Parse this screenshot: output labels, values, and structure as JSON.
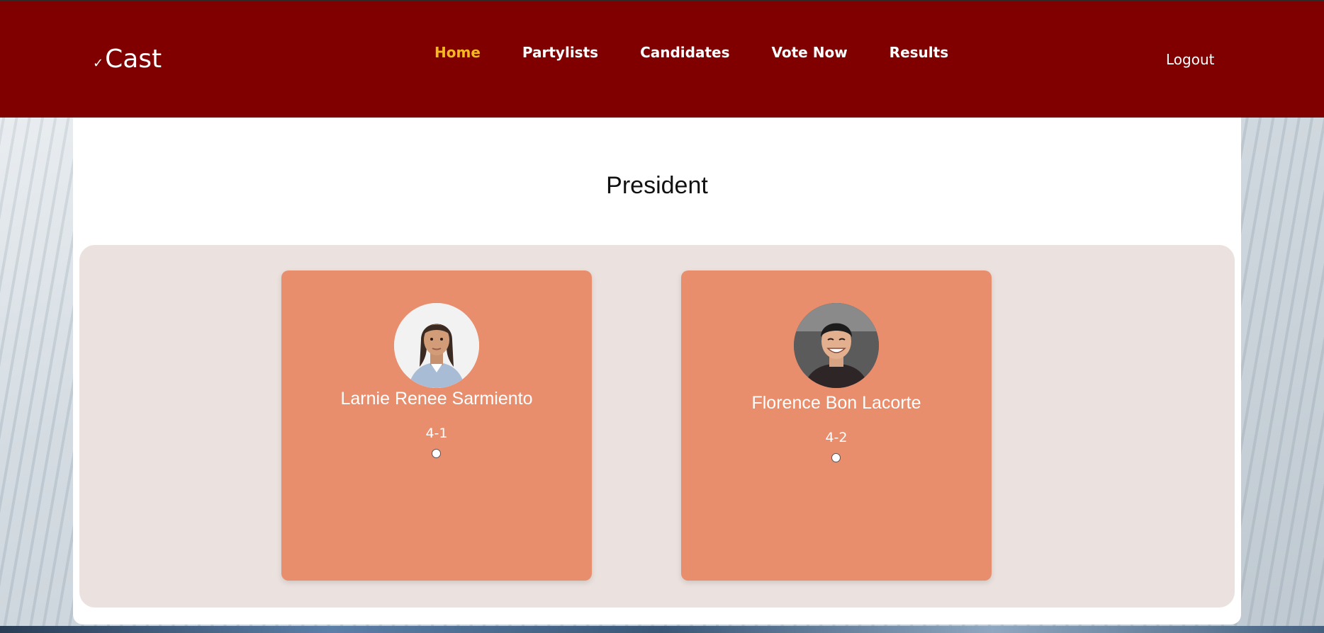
{
  "brand": {
    "logo_text": "Cast",
    "logo_mark": "✓"
  },
  "nav": {
    "items": [
      {
        "label": "Home",
        "active": true
      },
      {
        "label": "Partylists",
        "active": false
      },
      {
        "label": "Candidates",
        "active": false
      },
      {
        "label": "Vote Now",
        "active": false
      },
      {
        "label": "Results",
        "active": false
      }
    ],
    "logout_label": "Logout"
  },
  "ballot": {
    "position_title": "President",
    "candidates": [
      {
        "name": "Larnie Renee Sarmiento",
        "code": "4-1",
        "selected": false
      },
      {
        "name": "Florence Bon Lacorte",
        "code": "4-2",
        "selected": false
      }
    ]
  },
  "colors": {
    "header_bg": "#800000",
    "active_nav": "#f5b820",
    "card_bg": "#e98e6d",
    "cards_area_bg": "#ebe1de"
  }
}
